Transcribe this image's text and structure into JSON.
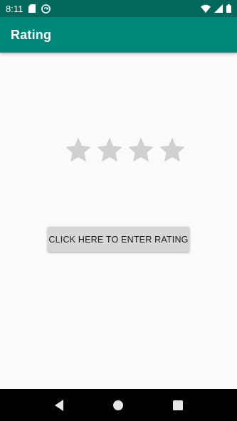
{
  "status_bar": {
    "time": "8:11",
    "icons": [
      "sd-card-icon",
      "sync-icon",
      "wifi-icon",
      "signal-icon",
      "battery-icon"
    ]
  },
  "app_bar": {
    "title": "Rating"
  },
  "rating": {
    "max_stars": 4,
    "value": 0,
    "star_empty_color": "#d0d0d0",
    "star_filled_color": "#ffb300"
  },
  "button": {
    "label": "CLICK HERE TO ENTER RATING"
  },
  "nav_bar": {
    "buttons": [
      "back-icon",
      "home-icon",
      "recents-icon"
    ]
  },
  "colors": {
    "primary": "#00897b",
    "primary_dark": "#00695c",
    "background": "#fafafa"
  }
}
